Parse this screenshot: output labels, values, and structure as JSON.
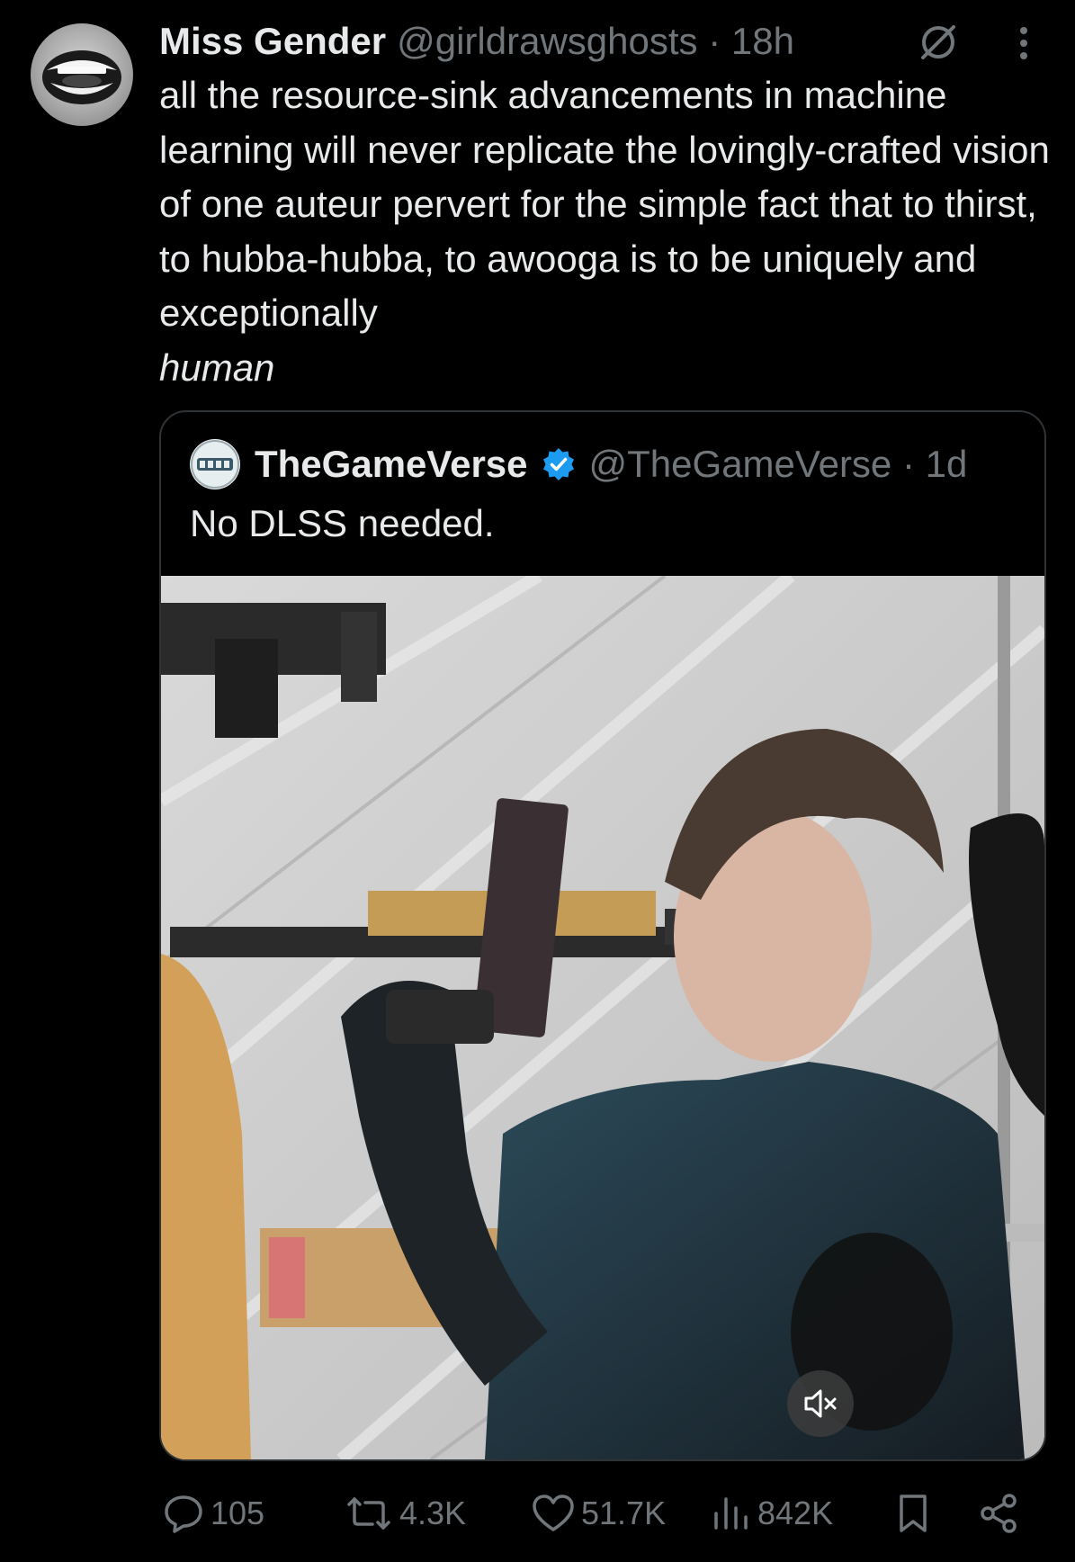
{
  "tweet": {
    "display_name": "Miss Gender",
    "handle": "@girldrawsghosts",
    "separator": "·",
    "time": "18h",
    "text_main": "all the resource-sink advancements in machine learning will never replicate the lovingly-crafted vision of one auteur pervert for the simple fact that to thirst, to hubba-hubba, to awooga is to be uniquely and exceptionally",
    "text_emphasis": "human"
  },
  "quote": {
    "display_name": "TheGameVerse",
    "handle": "@TheGameVerse",
    "separator": "·",
    "time": "1d",
    "text": "No DLSS needed."
  },
  "actions": {
    "replies": "105",
    "reposts": "4.3K",
    "likes": "51.7K",
    "views": "842K"
  },
  "icons": {
    "avatar": "avatar-mouth-image",
    "hidden": "no-symbol-icon",
    "more": "more-vertical-icon",
    "verified": "verified-badge-icon",
    "mute": "muted-speaker-icon",
    "reply": "reply-bubble-icon",
    "repost": "repost-icon",
    "like": "heart-icon",
    "views": "views-chart-icon",
    "bookmark": "bookmark-icon",
    "share": "share-icon"
  },
  "colors": {
    "background": "#000000",
    "text_primary": "#e7e9ea",
    "text_secondary": "#71767b",
    "border": "#2f3336",
    "verified": "#1d9bf0"
  }
}
